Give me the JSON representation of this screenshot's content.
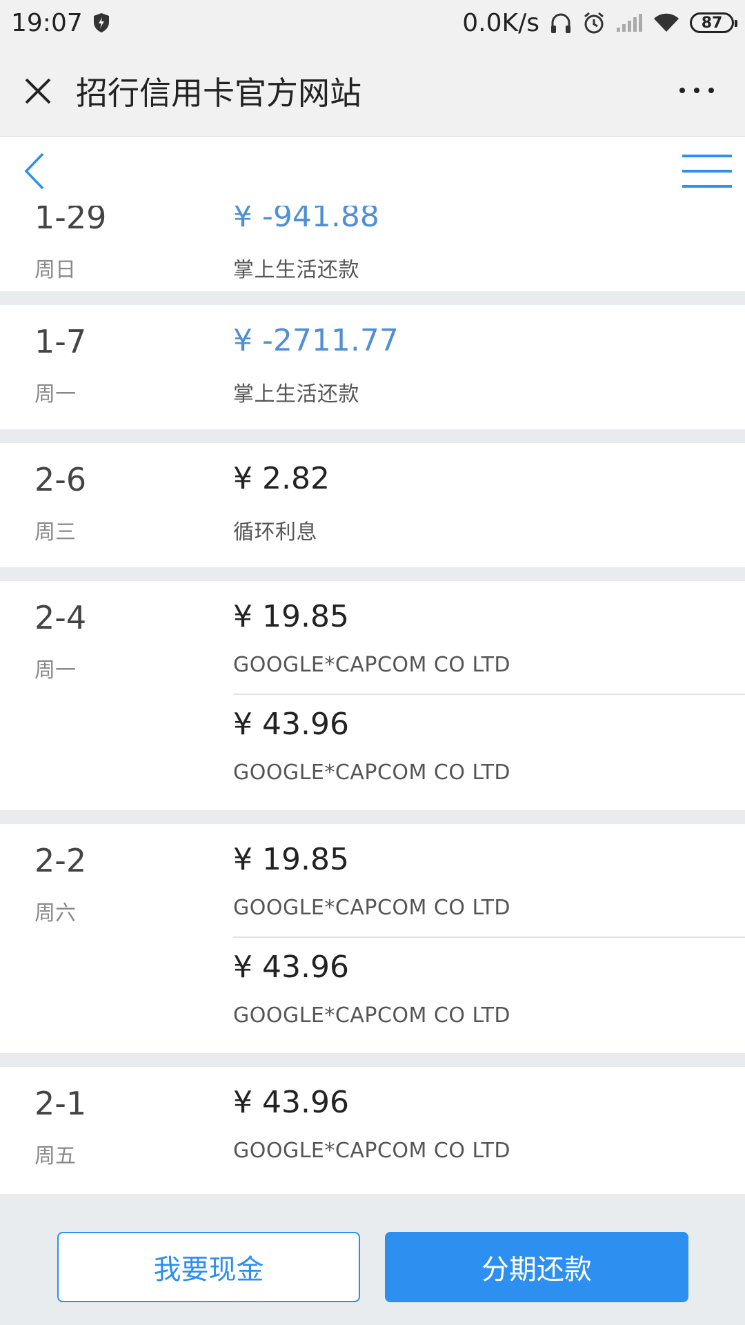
{
  "status_bar": {
    "time": "19:07",
    "network_speed": "0.0K/s",
    "battery": "87"
  },
  "title_bar": {
    "title": "招行信用卡官方网站"
  },
  "transactions": [
    {
      "date": "1-29",
      "weekday": "周日",
      "items": [
        {
          "amount": "¥ -941.88",
          "desc": "掌上生活还款"
        }
      ]
    },
    {
      "date": "1-7",
      "weekday": "周一",
      "items": [
        {
          "amount": "¥ -2711.77",
          "desc": "掌上生活还款"
        }
      ]
    },
    {
      "date": "2-6",
      "weekday": "周三",
      "items": [
        {
          "amount": "¥ 2.82",
          "desc": "循环利息"
        }
      ]
    },
    {
      "date": "2-4",
      "weekday": "周一",
      "items": [
        {
          "amount": "¥ 19.85",
          "desc": "GOOGLE*CAPCOM CO LTD"
        },
        {
          "amount": "¥ 43.96",
          "desc": "GOOGLE*CAPCOM CO LTD"
        }
      ]
    },
    {
      "date": "2-2",
      "weekday": "周六",
      "items": [
        {
          "amount": "¥ 19.85",
          "desc": "GOOGLE*CAPCOM CO LTD"
        },
        {
          "amount": "¥ 43.96",
          "desc": "GOOGLE*CAPCOM CO LTD"
        }
      ]
    },
    {
      "date": "2-1",
      "weekday": "周五",
      "items": [
        {
          "amount": "¥ 43.96",
          "desc": "GOOGLE*CAPCOM CO LTD"
        }
      ]
    }
  ],
  "bottom_bar": {
    "cash_label": "我要现金",
    "installment_label": "分期还款"
  },
  "colors": {
    "accent": "#2d8ff0",
    "negative_amount": "#4f8fd6"
  }
}
